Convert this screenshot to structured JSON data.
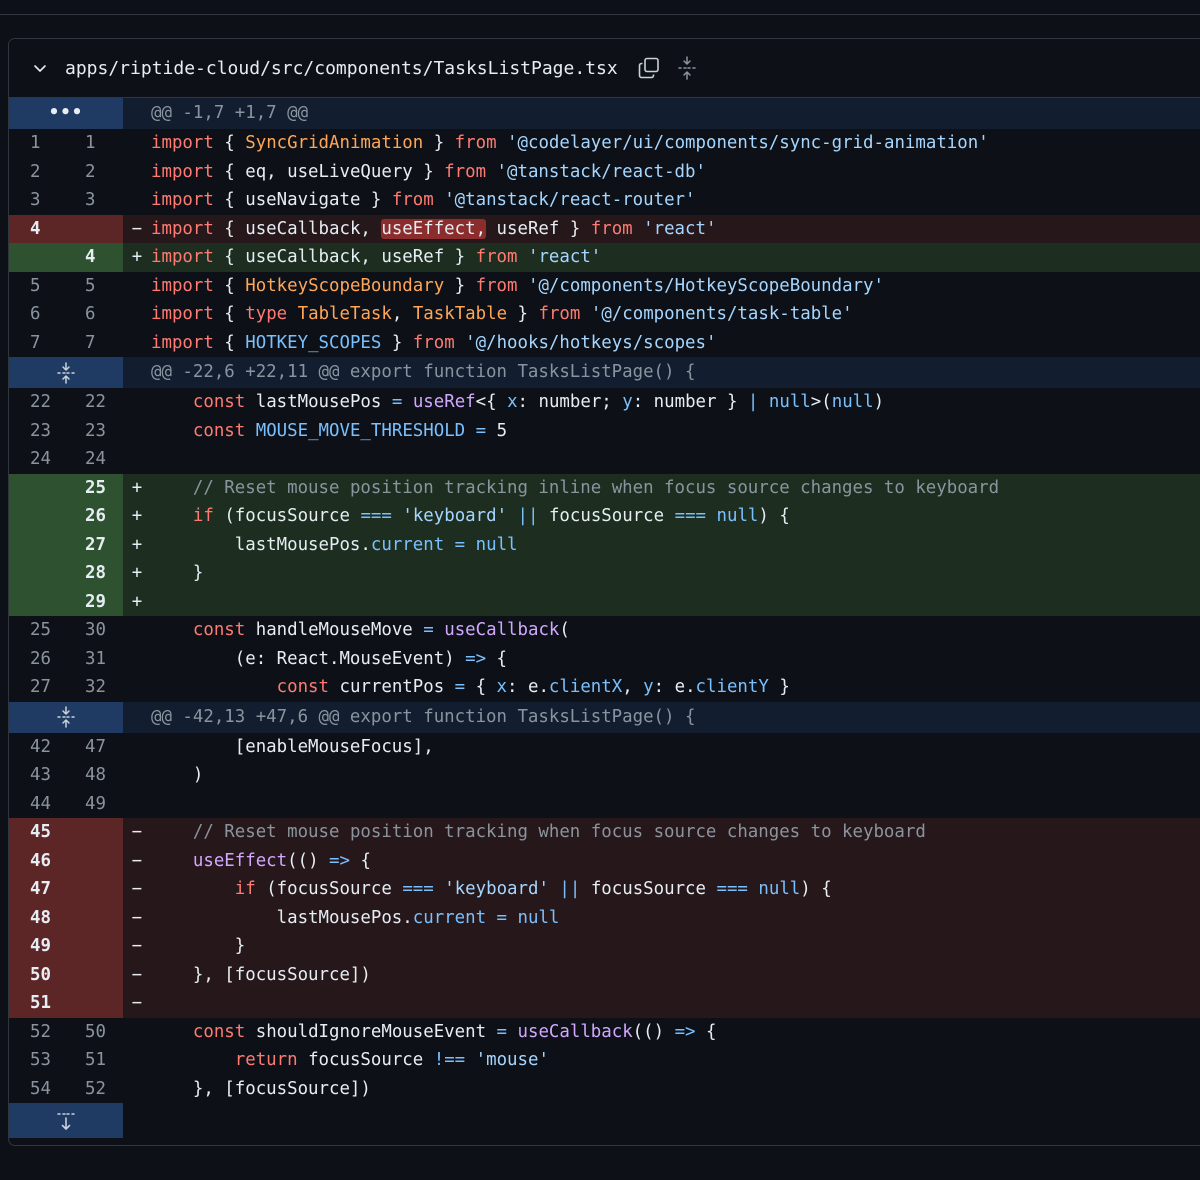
{
  "file": {
    "path": "apps/riptide-cloud/src/components/TasksListPage.tsx",
    "icons": {
      "collapse": "chevron-down-icon",
      "copy": "copy-icon",
      "expand": "expand-all-icon"
    }
  },
  "hunks": [
    {
      "header": "@@ -1,7 +1,7 @@",
      "gutter_icon": "ellipsis"
    },
    {
      "header": "@@ -22,6 +22,11 @@ export function TasksListPage() {",
      "gutter_icon": "expand-updown-icon"
    },
    {
      "header": "@@ -42,13 +47,6 @@ export function TasksListPage() {",
      "gutter_icon": "expand-updown-icon"
    }
  ],
  "lines": [
    {
      "type": "ctx",
      "old": "1",
      "new": "1",
      "marker": "",
      "code": "import { SyncGridAnimation } from '@codelayer/ui/components/sync-grid-animation'"
    },
    {
      "type": "ctx",
      "old": "2",
      "new": "2",
      "marker": "",
      "code": "import { eq, useLiveQuery } from '@tanstack/react-db'"
    },
    {
      "type": "ctx",
      "old": "3",
      "new": "3",
      "marker": "",
      "code": "import { useNavigate } from '@tanstack/react-router'"
    },
    {
      "type": "del",
      "old": "4",
      "new": "",
      "marker": "−",
      "code": "import { useCallback, useEffect, useRef } from 'react'"
    },
    {
      "type": "add",
      "old": "",
      "new": "4",
      "marker": "+",
      "code": "import { useCallback, useRef } from 'react'"
    },
    {
      "type": "ctx",
      "old": "5",
      "new": "5",
      "marker": "",
      "code": "import { HotkeyScopeBoundary } from '@/components/HotkeyScopeBoundary'"
    },
    {
      "type": "ctx",
      "old": "6",
      "new": "6",
      "marker": "",
      "code": "import { type TableTask, TaskTable } from '@/components/task-table'"
    },
    {
      "type": "ctx",
      "old": "7",
      "new": "7",
      "marker": "",
      "code": "import { HOTKEY_SCOPES } from '@/hooks/hotkeys/scopes'"
    },
    {
      "type": "ctx",
      "old": "22",
      "new": "22",
      "marker": "",
      "code": "    const lastMousePos = useRef<{ x: number; y: number } | null>(null)"
    },
    {
      "type": "ctx",
      "old": "23",
      "new": "23",
      "marker": "",
      "code": "    const MOUSE_MOVE_THRESHOLD = 5"
    },
    {
      "type": "ctx",
      "old": "24",
      "new": "24",
      "marker": "",
      "code": ""
    },
    {
      "type": "add",
      "old": "",
      "new": "25",
      "marker": "+",
      "code": "    // Reset mouse position tracking inline when focus source changes to keyboard"
    },
    {
      "type": "add",
      "old": "",
      "new": "26",
      "marker": "+",
      "code": "    if (focusSource === 'keyboard' || focusSource === null) {"
    },
    {
      "type": "add",
      "old": "",
      "new": "27",
      "marker": "+",
      "code": "        lastMousePos.current = null"
    },
    {
      "type": "add",
      "old": "",
      "new": "28",
      "marker": "+",
      "code": "    }"
    },
    {
      "type": "add",
      "old": "",
      "new": "29",
      "marker": "+",
      "code": ""
    },
    {
      "type": "ctx",
      "old": "25",
      "new": "30",
      "marker": "",
      "code": "    const handleMouseMove = useCallback("
    },
    {
      "type": "ctx",
      "old": "26",
      "new": "31",
      "marker": "",
      "code": "        (e: React.MouseEvent) => {"
    },
    {
      "type": "ctx",
      "old": "27",
      "new": "32",
      "marker": "",
      "code": "            const currentPos = { x: e.clientX, y: e.clientY }"
    },
    {
      "type": "ctx",
      "old": "42",
      "new": "47",
      "marker": "",
      "code": "        [enableMouseFocus],"
    },
    {
      "type": "ctx",
      "old": "43",
      "new": "48",
      "marker": "",
      "code": "    )"
    },
    {
      "type": "ctx",
      "old": "44",
      "new": "49",
      "marker": "",
      "code": ""
    },
    {
      "type": "del",
      "old": "45",
      "new": "",
      "marker": "−",
      "code": "    // Reset mouse position tracking when focus source changes to keyboard"
    },
    {
      "type": "del",
      "old": "46",
      "new": "",
      "marker": "−",
      "code": "    useEffect(() => {"
    },
    {
      "type": "del",
      "old": "47",
      "new": "",
      "marker": "−",
      "code": "        if (focusSource === 'keyboard' || focusSource === null) {"
    },
    {
      "type": "del",
      "old": "48",
      "new": "",
      "marker": "−",
      "code": "            lastMousePos.current = null"
    },
    {
      "type": "del",
      "old": "49",
      "new": "",
      "marker": "−",
      "code": "        }"
    },
    {
      "type": "del",
      "old": "50",
      "new": "",
      "marker": "−",
      "code": "    }, [focusSource])"
    },
    {
      "type": "del",
      "old": "51",
      "new": "",
      "marker": "−",
      "code": ""
    },
    {
      "type": "ctx",
      "old": "52",
      "new": "50",
      "marker": "",
      "code": "    const shouldIgnoreMouseEvent = useCallback(() => {"
    },
    {
      "type": "ctx",
      "old": "53",
      "new": "51",
      "marker": "",
      "code": "        return focusSource !== 'mouse'"
    },
    {
      "type": "ctx",
      "old": "54",
      "new": "52",
      "marker": "",
      "code": "    }, [focusSource])"
    }
  ],
  "colors": {
    "background": "#0d1117",
    "hunk_gutter": "#1f3a63",
    "del_gutter": "#5c2626",
    "add_gutter": "#2e5230",
    "keyword": "#ff7b72",
    "string": "#a5d6ff",
    "constant": "#79c0ff",
    "function": "#d2a8ff"
  }
}
